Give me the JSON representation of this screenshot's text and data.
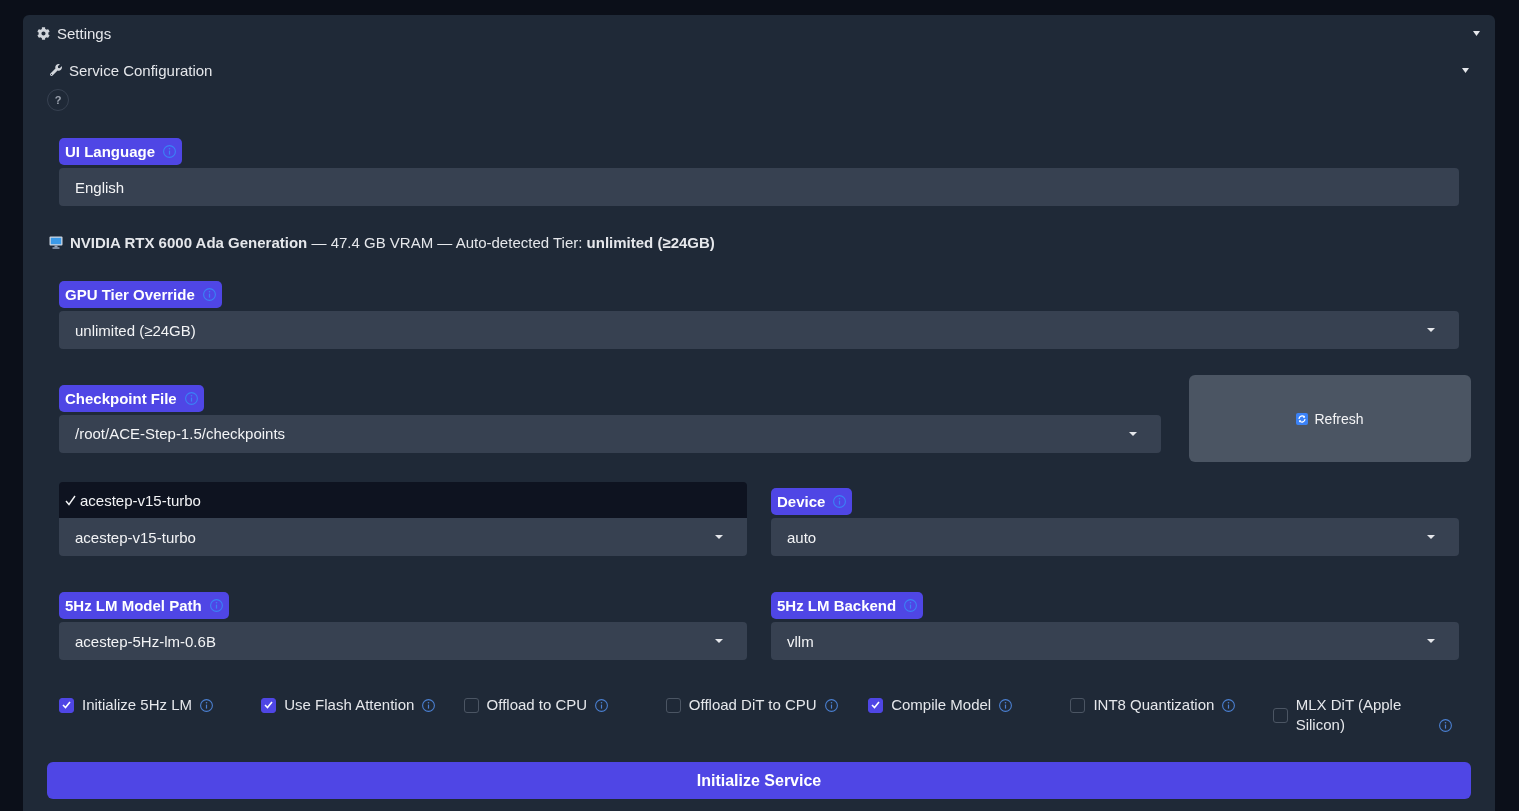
{
  "settings": {
    "title": "Settings",
    "expanded": true,
    "service_configuration": {
      "title": "Service Configuration",
      "expanded": true,
      "help": "?",
      "ui_language": {
        "label": "UI Language",
        "kind": "textbox",
        "value": "English"
      },
      "gpu_info": "**NVIDIA RTX 6000 Ada Generation** — 47.4 GB VRAM — Auto-detected Tier: **unlimited (≥24GB)**",
      "gpu_tier_override": {
        "label": "GPU Tier Override",
        "kind": "dropdown",
        "value": "unlimited (≥24GB)"
      },
      "checkpoint_file": {
        "label": "Checkpoint File",
        "kind": "dropdown",
        "value": "/root/ACE-Step-1.5/checkpoints"
      },
      "refresh_button": "Refresh",
      "model": {
        "kind": "dropdown",
        "menu": [
          {
            "label": "acestep-v15-turbo",
            "selected": true
          }
        ],
        "value": "acestep-v15-turbo"
      },
      "device": {
        "label": "Device",
        "kind": "dropdown",
        "value": "auto"
      },
      "lm_model_path": {
        "label": "5Hz LM Model Path",
        "kind": "dropdown",
        "value": "acestep-5Hz-lm-0.6B"
      },
      "lm_backend": {
        "label": "5Hz LM Backend",
        "kind": "dropdown",
        "value": "vllm"
      },
      "options": [
        {
          "label": "Initialize 5Hz LM",
          "checked": true
        },
        {
          "label": "Use Flash Attention",
          "checked": true
        },
        {
          "label": "Offload to CPU",
          "checked": false
        },
        {
          "label": "Offload DiT to CPU",
          "checked": false
        },
        {
          "label": "Compile Model",
          "checked": true
        },
        {
          "label": "INT8 Quantization",
          "checked": false
        },
        {
          "label": "MLX DiT (Apple Silicon)",
          "checked": false
        }
      ],
      "initialize_button": "Initialize Service"
    }
  }
}
